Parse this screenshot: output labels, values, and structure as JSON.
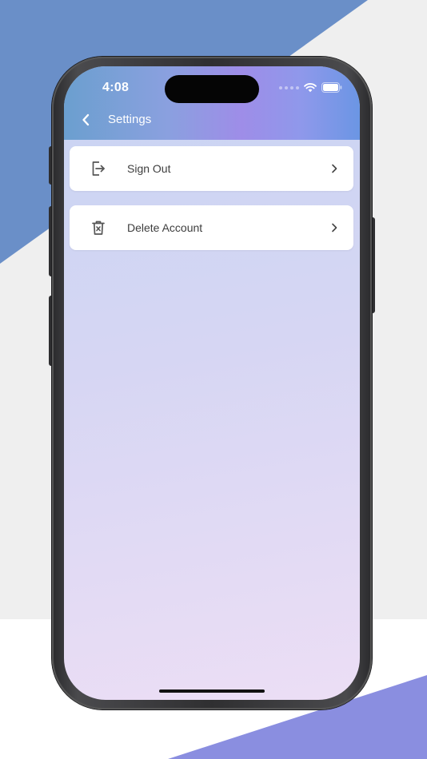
{
  "status_bar": {
    "time": "4:08"
  },
  "nav": {
    "title": "Settings",
    "back_icon": "chevron-left-icon"
  },
  "menu": {
    "items": [
      {
        "label": "Sign Out",
        "icon": "sign-out-icon"
      },
      {
        "label": "Delete Account",
        "icon": "trash-icon"
      }
    ]
  },
  "colors": {
    "background_blue": "#6a8fc8",
    "background_purple": "#8a8ee0",
    "header_start": "#6b9fcf",
    "header_mid": "#9e8de8",
    "header_end": "#6b96e4",
    "card": "#ffffff",
    "text": "#3d3d3d"
  }
}
